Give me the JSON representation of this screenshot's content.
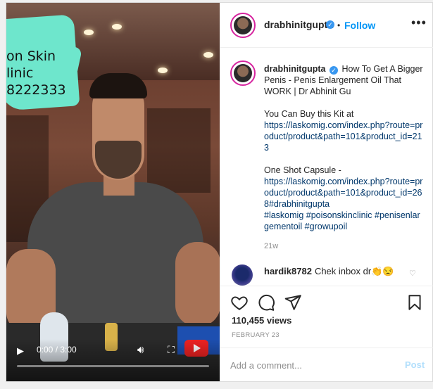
{
  "video": {
    "overlay_lines": [
      "on Skin",
      "linic",
      "8222333"
    ],
    "time": "0:00 / 3:00",
    "progress_fraction": 0.0
  },
  "header": {
    "username": "drabhinitgupta",
    "follow_label": "Follow",
    "dot": "•",
    "more_glyph": "•••"
  },
  "caption": {
    "username": "drabhinitgupta",
    "title": "How To Get A Bigger Penis - Penis Enlargement Oil That WORK | Dr Abhinit Gu",
    "kit_text": "You Can Buy this Kit at",
    "kit_link": "https://laskomig.com/index.php?route=product/product&path=101&product_id=213",
    "capsule_text": "One Shot Capsule -",
    "capsule_link": "https://laskomig.com/index.php?route=product/product&path=101&product_id=268#drabhinitgupta",
    "hashtags": "#laskomig #poisonskinclinic #penisenlargementoil #growupoil",
    "age": "21w"
  },
  "comment": {
    "username": "hardik8782",
    "text": "Chek inbox dr👏😒"
  },
  "actions": {
    "views": "110,455 views",
    "date": "FEBRUARY 23"
  },
  "add_comment": {
    "placeholder": "Add a comment...",
    "post_label": "Post"
  },
  "colors": {
    "accent": "#0095f6",
    "link": "#00376b",
    "verified": "#3897f0",
    "post_disabled": "#b2dffc"
  }
}
